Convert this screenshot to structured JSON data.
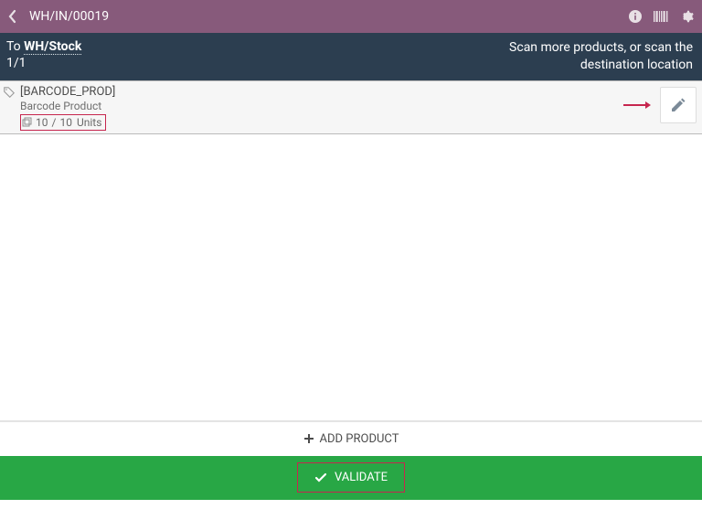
{
  "header": {
    "title": "WH/IN/00019"
  },
  "subheader": {
    "to_label": "To",
    "to_location": "WH/Stock",
    "pager": "1/1",
    "hint_line1": "Scan more products, or scan the",
    "hint_line2": "destination location"
  },
  "lines": [
    {
      "reference": "[BARCODE_PROD]",
      "name": "Barcode Product",
      "qty_done": "10",
      "qty_sep": "/",
      "qty_total": "10",
      "uom": "Units"
    }
  ],
  "buttons": {
    "add_product": "ADD PRODUCT",
    "validate": "VALIDATE"
  }
}
